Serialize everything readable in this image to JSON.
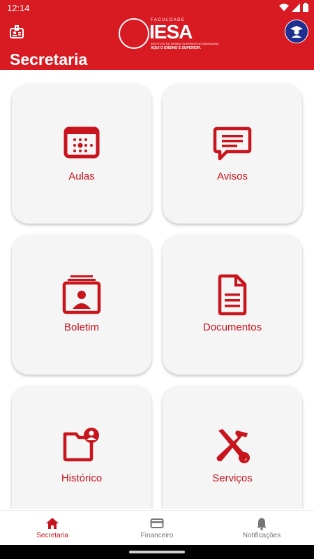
{
  "status": {
    "time": "12:14"
  },
  "header": {
    "title": "Secretaria",
    "logo": {
      "top": "FACULDADE",
      "name": "IESA",
      "subline": "INSTITUTO DE ENSINO SUPERIOR DE ANDRADINA",
      "tagline": "AQUI O ENSINO É SUPERIOR."
    }
  },
  "cards": [
    {
      "label": "Aulas",
      "icon": "calendar-icon"
    },
    {
      "label": "Avisos",
      "icon": "message-icon"
    },
    {
      "label": "Boletim",
      "icon": "report-card-icon"
    },
    {
      "label": "Documentos",
      "icon": "document-icon"
    },
    {
      "label": "Histórico",
      "icon": "folder-user-icon"
    },
    {
      "label": "Serviços",
      "icon": "tools-icon"
    }
  ],
  "bottom_nav": [
    {
      "label": "Secretaria",
      "icon": "home-icon",
      "active": true
    },
    {
      "label": "Financeiro",
      "icon": "credit-card-icon",
      "active": false
    },
    {
      "label": "Notificações",
      "icon": "bell-icon",
      "active": false
    }
  ],
  "colors": {
    "primary": "#d81b22",
    "card_bg": "#f5f5f5",
    "avatar_bg": "#1f2f8f",
    "nav_inactive": "#757575"
  }
}
